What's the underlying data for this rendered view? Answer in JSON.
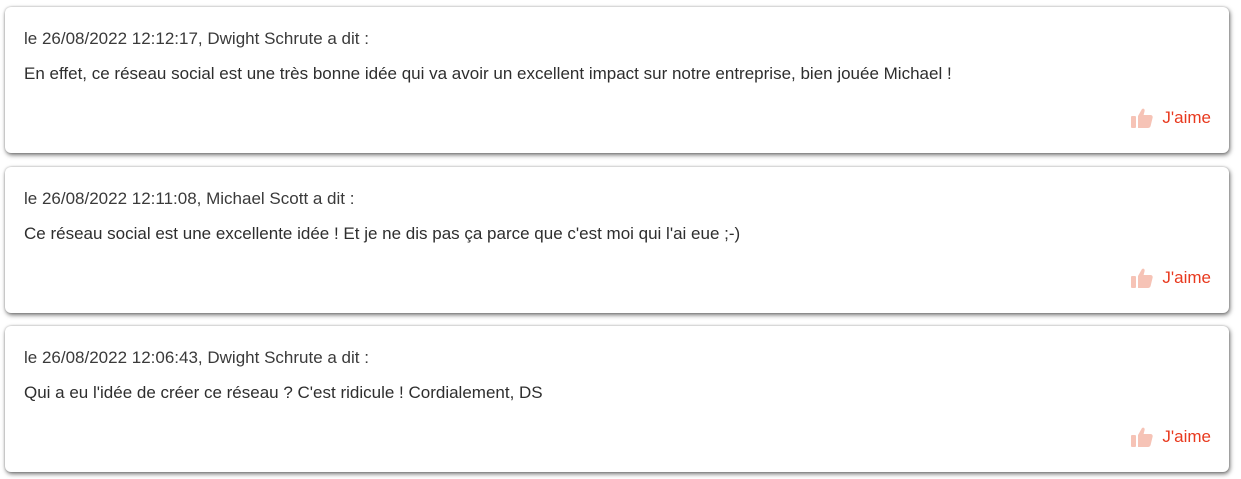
{
  "colors": {
    "like_accent": "#e8391e",
    "like_icon": "#f6c3b6",
    "text": "#2e2e2e"
  },
  "comments": [
    {
      "meta": "le 26/08/2022 12:12:17, Dwight Schrute a dit :",
      "body": "En effet, ce réseau social est une très bonne idée qui va avoir un excellent impact sur notre entreprise, bien jouée Michael !",
      "like_label": "J'aime",
      "like_icon": "thumbs-up-icon"
    },
    {
      "meta": "le 26/08/2022 12:11:08, Michael Scott a dit :",
      "body": "Ce réseau social est une excellente idée ! Et je ne dis pas ça parce que c'est moi qui l'ai eue ;-)",
      "like_label": "J'aime",
      "like_icon": "thumbs-up-icon"
    },
    {
      "meta": "le 26/08/2022 12:06:43, Dwight Schrute a dit :",
      "body": "Qui a eu l'idée de créer ce réseau ? C'est ridicule ! Cordialement, DS",
      "like_label": "J'aime",
      "like_icon": "thumbs-up-icon"
    }
  ]
}
